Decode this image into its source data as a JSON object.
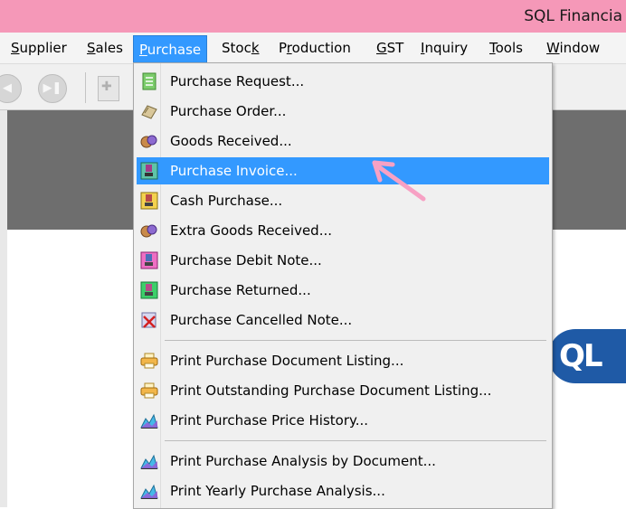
{
  "window": {
    "title": "SQL Financia"
  },
  "menubar": {
    "items": [
      {
        "key": "supplier",
        "label": "Supplier",
        "accel": "S",
        "rest": "upplier",
        "active": false
      },
      {
        "key": "sales",
        "label": "Sales",
        "accel": "S",
        "rest": "ales",
        "active": false
      },
      {
        "key": "purchase",
        "label": "Purchase",
        "accel": "P",
        "rest": "urchase",
        "active": true
      },
      {
        "key": "stock",
        "label": "Stock",
        "accel": "k",
        "rest": "Stoc",
        "accel_last": true,
        "active": false
      },
      {
        "key": "production",
        "label": "Production",
        "accel": "r",
        "rest": "P|oduction",
        "active": false
      },
      {
        "key": "gst",
        "label": "GST",
        "accel": "G",
        "rest": "ST",
        "active": false
      },
      {
        "key": "inquiry",
        "label": "Inquiry",
        "accel": "I",
        "rest": "nquiry",
        "active": false
      },
      {
        "key": "tools",
        "label": "Tools",
        "accel": "T",
        "rest": "ools",
        "active": false
      },
      {
        "key": "window",
        "label": "Window",
        "accel": "W",
        "rest": "indow",
        "active": false
      }
    ]
  },
  "purchase_menu": {
    "items": [
      {
        "label": "Purchase Request...",
        "icon": "purchase-request-icon",
        "highlight": false
      },
      {
        "label": "Purchase Order...",
        "icon": "purchase-order-icon",
        "highlight": false
      },
      {
        "label": "Goods Received...",
        "icon": "goods-received-icon",
        "highlight": false
      },
      {
        "label": "Purchase Invoice...",
        "icon": "purchase-invoice-icon",
        "highlight": true
      },
      {
        "label": "Cash Purchase...",
        "icon": "cash-purchase-icon",
        "highlight": false
      },
      {
        "label": "Extra Goods Received...",
        "icon": "extra-goods-received-icon",
        "highlight": false
      },
      {
        "label": "Purchase Debit Note...",
        "icon": "purchase-debit-note-icon",
        "highlight": false
      },
      {
        "label": "Purchase Returned...",
        "icon": "purchase-returned-icon",
        "highlight": false
      },
      {
        "label": "Purchase Cancelled Note...",
        "icon": "purchase-cancelled-note-icon",
        "highlight": false
      },
      {
        "label": "Print Purchase Document Listing...",
        "icon": "printer-icon",
        "highlight": false
      },
      {
        "label": "Print Outstanding Purchase Document Listing...",
        "icon": "printer-icon",
        "highlight": false
      },
      {
        "label": "Print Purchase Price History...",
        "icon": "chart-icon",
        "highlight": false
      },
      {
        "label": "Print Purchase Analysis by Document...",
        "icon": "chart-icon",
        "highlight": false
      },
      {
        "label": "Print Yearly Purchase Analysis...",
        "icon": "chart-icon",
        "highlight": false
      }
    ]
  },
  "colors": {
    "titlebar": "#f598b8",
    "highlight": "#3399ff",
    "annotation_arrow": "#f7a1c4",
    "logo": "#1f5aa6"
  },
  "logo": {
    "text": "QL"
  }
}
